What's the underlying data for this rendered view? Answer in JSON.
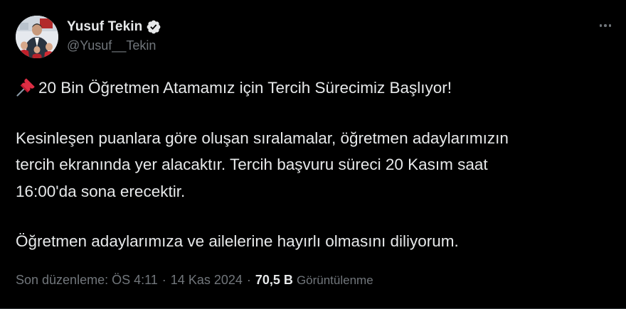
{
  "author": {
    "display_name": "Yusuf Tekin",
    "handle": "@Yusuf__Tekin",
    "verified": true,
    "verified_color": "#1d9bf0"
  },
  "tweet": {
    "title_emoji": "pushpin",
    "title": "20 Bin Öğretmen Atamamız için Tercih Sürecimiz Başlıyor!",
    "paragraph_1_line_1": "Kesinleşen puanlara göre oluşan sıralamalar, öğretmen adaylarımızın",
    "paragraph_1_line_2": "tercih ekranında yer alacaktır. Tercih başvuru süreci 20 Kasım saat",
    "paragraph_1_line_3": "16:00'da sona erecektir.",
    "paragraph_2": "Öğretmen adaylarımıza ve ailelerine hayırlı olmasını diliyorum."
  },
  "meta": {
    "edited_time": "Son düzenleme: ÖS 4:11",
    "date": "14 Kas 2024",
    "separator": "·",
    "views_count": "70,5 B",
    "views_label": "Görüntülenme"
  },
  "colors": {
    "background": "#000000",
    "text_primary": "#e7e9ea",
    "text_secondary": "#71767b"
  }
}
